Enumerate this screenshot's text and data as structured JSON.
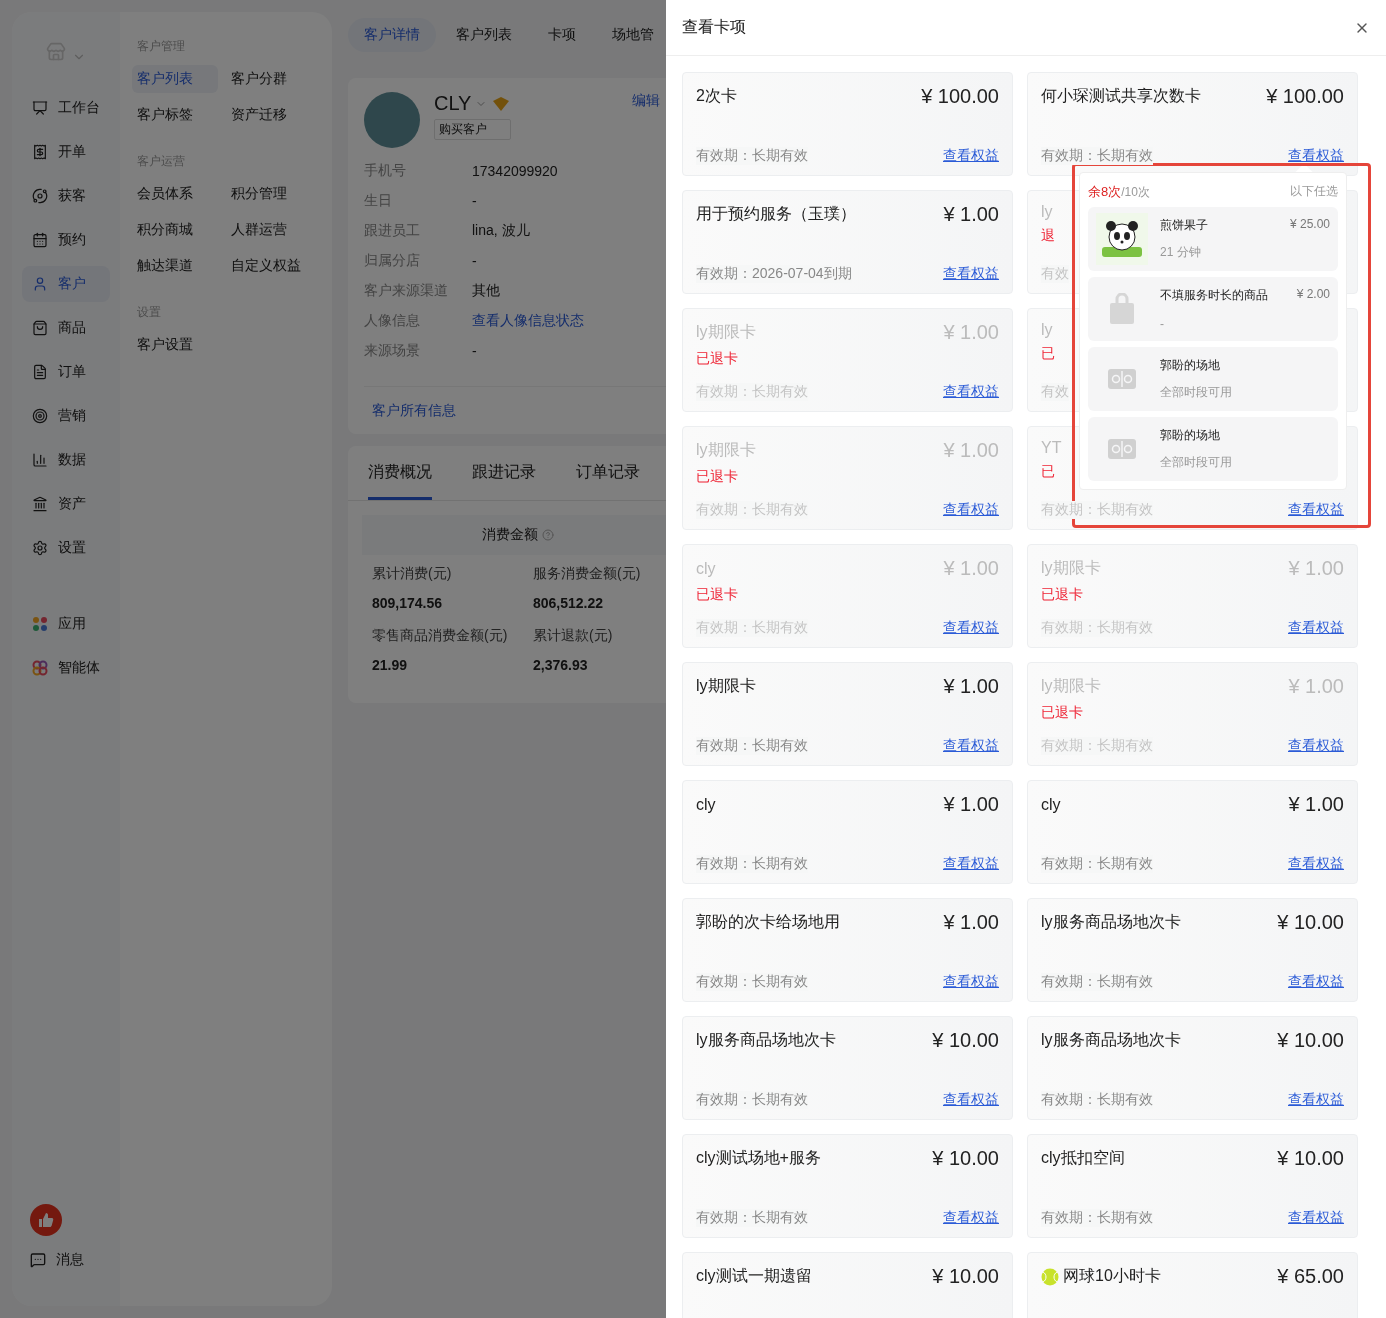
{
  "sidebar": {
    "items": [
      {
        "label": "工作台",
        "selected": false
      },
      {
        "label": "开单",
        "selected": false
      },
      {
        "label": "获客",
        "selected": false
      },
      {
        "label": "预约",
        "selected": false
      },
      {
        "label": "客户",
        "selected": true
      },
      {
        "label": "商品",
        "selected": false
      },
      {
        "label": "订单",
        "selected": false
      },
      {
        "label": "营销",
        "selected": false
      },
      {
        "label": "数据",
        "selected": false
      },
      {
        "label": "资产",
        "selected": false
      },
      {
        "label": "设置",
        "selected": false
      }
    ],
    "extra_items": [
      {
        "label": "应用",
        "selected": false
      },
      {
        "label": "智能体",
        "selected": false
      }
    ],
    "message": {
      "label": "消息"
    }
  },
  "submenu": {
    "groups": [
      {
        "title": "客户管理",
        "items": [
          {
            "label": "客户列表",
            "selected": true
          },
          {
            "label": "客户分群",
            "selected": false
          },
          {
            "label": "客户标签",
            "selected": false
          },
          {
            "label": "资产迁移",
            "selected": false
          }
        ]
      },
      {
        "title": "客户运营",
        "items": [
          {
            "label": "会员体系",
            "selected": false
          },
          {
            "label": "积分管理",
            "selected": false
          },
          {
            "label": "积分商城",
            "selected": false
          },
          {
            "label": "人群运营",
            "selected": false
          },
          {
            "label": "触达渠道",
            "selected": false
          },
          {
            "label": "自定义权益",
            "selected": false
          }
        ]
      },
      {
        "title": "设置",
        "items": [
          {
            "label": "客户设置",
            "selected": false
          }
        ]
      }
    ]
  },
  "page_tabs": [
    {
      "label": "客户详情",
      "selected": true
    },
    {
      "label": "客户列表",
      "selected": false
    },
    {
      "label": "卡项",
      "selected": false
    },
    {
      "label": "场地管",
      "selected": false
    }
  ],
  "profile": {
    "name": "CLY",
    "tag": "购买客户",
    "edit": "编辑",
    "fields": [
      {
        "label": "手机号",
        "value": "17342099920",
        "link": false
      },
      {
        "label": "生日",
        "value": "-",
        "link": false
      },
      {
        "label": "跟进员工",
        "value": "lina, 波儿",
        "link": false
      },
      {
        "label": "归属分店",
        "value": "-",
        "link": false
      },
      {
        "label": "客户来源渠道",
        "value": "其他",
        "link": false
      },
      {
        "label": "人像信息",
        "value": "查看人像信息状态",
        "link": true
      },
      {
        "label": "来源场景",
        "value": "-",
        "link": false
      }
    ],
    "all_info": "客户所有信息"
  },
  "detail_tabs": [
    {
      "label": "消费概况",
      "selected": true
    },
    {
      "label": "跟进记录",
      "selected": false
    },
    {
      "label": "订单记录",
      "selected": false
    }
  ],
  "summary": {
    "title": "消费金额",
    "stats": [
      {
        "label": "累计消费(元)",
        "value": "809,174.56"
      },
      {
        "label": "服务消费金额(元)",
        "value": "806,512.22"
      },
      {
        "label": "零售商品消费金额(元)",
        "value": "21.99"
      },
      {
        "label": "累计退款(元)",
        "value": "2,376.93"
      }
    ]
  },
  "drawer": {
    "title": "查看卡项",
    "cards": [
      {
        "name": "2次卡",
        "price": "¥ 100.00",
        "refunded": false,
        "validity": "有效期：长期有效",
        "link": "查看权益"
      },
      {
        "name": "何小琛测试共享次数卡",
        "price": "¥ 100.00",
        "refunded": false,
        "validity": "有效期：长期有效",
        "link": "查看权益"
      },
      {
        "name": "用于预约服务（玉璞）",
        "price": "¥ 1.00",
        "refunded": false,
        "validity": "有效期：2026-07-04到期",
        "link": "查看权益"
      },
      {
        "name": "ly",
        "refunded": true,
        "status": "退",
        "validity": "有效"
      },
      {
        "name": "ly期限卡",
        "price": "¥ 1.00",
        "refunded": true,
        "status": "已退卡",
        "validity": "有效期：长期有效",
        "link": "查看权益"
      },
      {
        "name": "ly",
        "refunded": true,
        "status": "已",
        "validity": "有效"
      },
      {
        "name": "ly期限卡",
        "price": "¥ 1.00",
        "refunded": true,
        "status": "已退卡",
        "validity": "有效期：长期有效",
        "link": "查看权益"
      },
      {
        "name": "YT",
        "refunded": true,
        "status": "已",
        "validity": "有效期：长期有效",
        "link": "查看权益"
      },
      {
        "name": "cly",
        "price": "¥ 1.00",
        "refunded": true,
        "status": "已退卡",
        "validity": "有效期：长期有效",
        "link": "查看权益"
      },
      {
        "name": "ly期限卡",
        "price": "¥ 1.00",
        "refunded": true,
        "status": "已退卡",
        "validity": "有效期：长期有效",
        "link": "查看权益"
      },
      {
        "name": "ly期限卡",
        "price": "¥ 1.00",
        "refunded": false,
        "validity": "有效期：长期有效",
        "link": "查看权益"
      },
      {
        "name": "ly期限卡",
        "price": "¥ 1.00",
        "refunded": true,
        "status": "已退卡",
        "validity": "有效期：长期有效",
        "link": "查看权益"
      },
      {
        "name": "cly",
        "price": "¥ 1.00",
        "refunded": false,
        "validity": "有效期：长期有效",
        "link": "查看权益"
      },
      {
        "name": "cly",
        "price": "¥ 1.00",
        "refunded": false,
        "validity": "有效期：长期有效",
        "link": "查看权益"
      },
      {
        "name": "郭盼的次卡给场地用",
        "price": "¥ 1.00",
        "refunded": false,
        "validity": "有效期：长期有效",
        "link": "查看权益"
      },
      {
        "name": "ly服务商品场地次卡",
        "price": "¥ 10.00",
        "refunded": false,
        "validity": "有效期：长期有效",
        "link": "查看权益"
      },
      {
        "name": "ly服务商品场地次卡",
        "price": "¥ 10.00",
        "refunded": false,
        "validity": "有效期：长期有效",
        "link": "查看权益"
      },
      {
        "name": "ly服务商品场地次卡",
        "price": "¥ 10.00",
        "refunded": false,
        "validity": "有效期：长期有效",
        "link": "查看权益"
      },
      {
        "name": "cly测试场地+服务",
        "price": "¥ 10.00",
        "refunded": false,
        "validity": "有效期：长期有效",
        "link": "查看权益"
      },
      {
        "name": "cly抵扣空间",
        "price": "¥ 10.00",
        "refunded": false,
        "validity": "有效期：长期有效",
        "link": "查看权益"
      },
      {
        "name": "cly测试一期遗留",
        "price": "¥ 10.00",
        "refunded": false
      },
      {
        "name": "网球10小时卡",
        "price": "¥ 65.00",
        "refunded": false,
        "ball": true
      }
    ],
    "popover": {
      "remaining": "余8次",
      "total": "/10次",
      "hint": "以下任选",
      "items": [
        {
          "kind": "photo",
          "name": "煎饼果子",
          "price": "¥ 25.00",
          "sub": "21 分钟"
        },
        {
          "kind": "bag",
          "name": "不填服务时长的商品",
          "price": "¥ 2.00",
          "sub": "-"
        },
        {
          "kind": "venue",
          "name": "郭盼的场地",
          "sub": "全部时段可用"
        },
        {
          "kind": "venue",
          "name": "郭盼的场地",
          "sub": "全部时段可用"
        }
      ]
    }
  }
}
